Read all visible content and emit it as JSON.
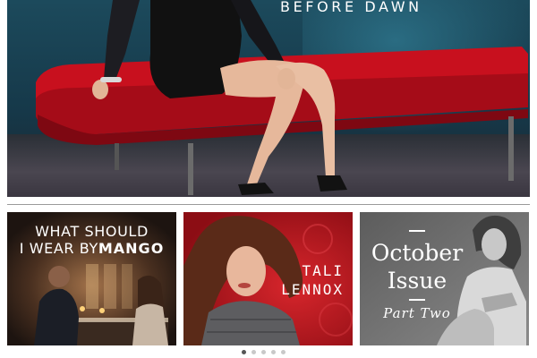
{
  "hero": {
    "title": "BEFORE DAWN",
    "image_alt": "model seated on a red bench"
  },
  "tiles": [
    {
      "caption_line1": "WHAT SHOULD",
      "caption_line2_prefix": "I WEAR BY",
      "caption_brand": "MANGO",
      "image_alt": "couple dining by candlelight"
    },
    {
      "caption_line1": "TALI",
      "caption_line2": "LENNOX",
      "image_alt": "woman with windswept hair on red background"
    },
    {
      "caption_line1": "October",
      "caption_line2": "Issue",
      "caption_part": "Part Two",
      "image_alt": "black and white portrait of a seated woman"
    }
  ],
  "pager": {
    "total": 5,
    "active_index": 0
  },
  "colors": {
    "hero_bench": "#c8101e",
    "tali_background": "#b4151c",
    "pager_active": "#555555",
    "pager_inactive": "#c8c8c8"
  }
}
